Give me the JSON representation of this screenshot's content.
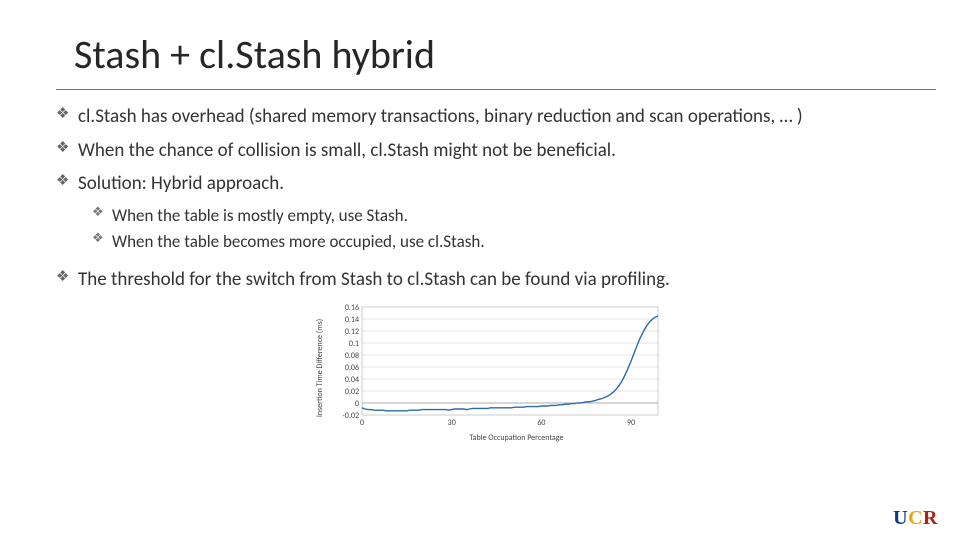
{
  "title": "Stash + cl.Stash hybrid",
  "bullets": [
    "cl.Stash has overhead (shared memory transactions, binary reduction and scan operations, … )",
    "When the chance of collision is small, cl.Stash might not be beneficial.",
    "Solution: Hybrid approach."
  ],
  "sub_bullets": [
    "When the table is mostly empty, use Stash.",
    "When the table becomes more occupied, use cl.Stash."
  ],
  "bullet_after_sub": "The threshold for the switch from Stash to cl.Stash can be found via profiling.",
  "chart_data": {
    "type": "line",
    "xlabel": "Table Occupation Percentage",
    "ylabel": "Insertion Time Difference (ms)",
    "y_ticks": [
      -0.02,
      0,
      0.02,
      0.04,
      0.06,
      0.08,
      0.1,
      0.12,
      0.14,
      0.16
    ],
    "x_ticks": [
      0,
      30,
      60,
      90
    ],
    "ylim": [
      -0.02,
      0.16
    ],
    "xlim": [
      0,
      99
    ],
    "x": [
      0,
      1,
      2,
      3,
      4,
      5,
      6,
      7,
      8,
      9,
      10,
      11,
      12,
      13,
      14,
      15,
      16,
      17,
      18,
      19,
      20,
      21,
      22,
      23,
      24,
      25,
      26,
      27,
      28,
      29,
      30,
      31,
      32,
      33,
      34,
      35,
      36,
      37,
      38,
      39,
      40,
      41,
      42,
      43,
      44,
      45,
      46,
      47,
      48,
      49,
      50,
      51,
      52,
      53,
      54,
      55,
      56,
      57,
      58,
      59,
      60,
      61,
      62,
      63,
      64,
      65,
      66,
      67,
      68,
      69,
      70,
      71,
      72,
      73,
      74,
      75,
      76,
      77,
      78,
      79,
      80,
      81,
      82,
      83,
      84,
      85,
      86,
      87,
      88,
      89,
      90,
      91,
      92,
      93,
      94,
      95,
      96,
      97,
      98,
      99
    ],
    "values": [
      -0.008,
      -0.01,
      -0.011,
      -0.011,
      -0.012,
      -0.012,
      -0.012,
      -0.012,
      -0.013,
      -0.013,
      -0.013,
      -0.013,
      -0.013,
      -0.013,
      -0.013,
      -0.013,
      -0.012,
      -0.012,
      -0.012,
      -0.012,
      -0.011,
      -0.011,
      -0.011,
      -0.011,
      -0.011,
      -0.011,
      -0.011,
      -0.011,
      -0.011,
      -0.012,
      -0.011,
      -0.01,
      -0.01,
      -0.01,
      -0.01,
      -0.011,
      -0.01,
      -0.009,
      -0.009,
      -0.009,
      -0.009,
      -0.009,
      -0.009,
      -0.008,
      -0.008,
      -0.008,
      -0.008,
      -0.008,
      -0.008,
      -0.008,
      -0.008,
      -0.007,
      -0.007,
      -0.007,
      -0.007,
      -0.006,
      -0.006,
      -0.006,
      -0.006,
      -0.006,
      -0.005,
      -0.005,
      -0.005,
      -0.004,
      -0.004,
      -0.004,
      -0.003,
      -0.003,
      -0.002,
      -0.002,
      -0.001,
      -0.001,
      0.0,
      0.0,
      0.001,
      0.002,
      0.002,
      0.003,
      0.004,
      0.006,
      0.007,
      0.009,
      0.011,
      0.014,
      0.018,
      0.023,
      0.029,
      0.037,
      0.047,
      0.058,
      0.07,
      0.083,
      0.096,
      0.108,
      0.118,
      0.127,
      0.134,
      0.139,
      0.143,
      0.145
    ],
    "line_color": "#2b6aa9"
  },
  "logo": {
    "u": "U",
    "c": "C",
    "r": "R"
  }
}
